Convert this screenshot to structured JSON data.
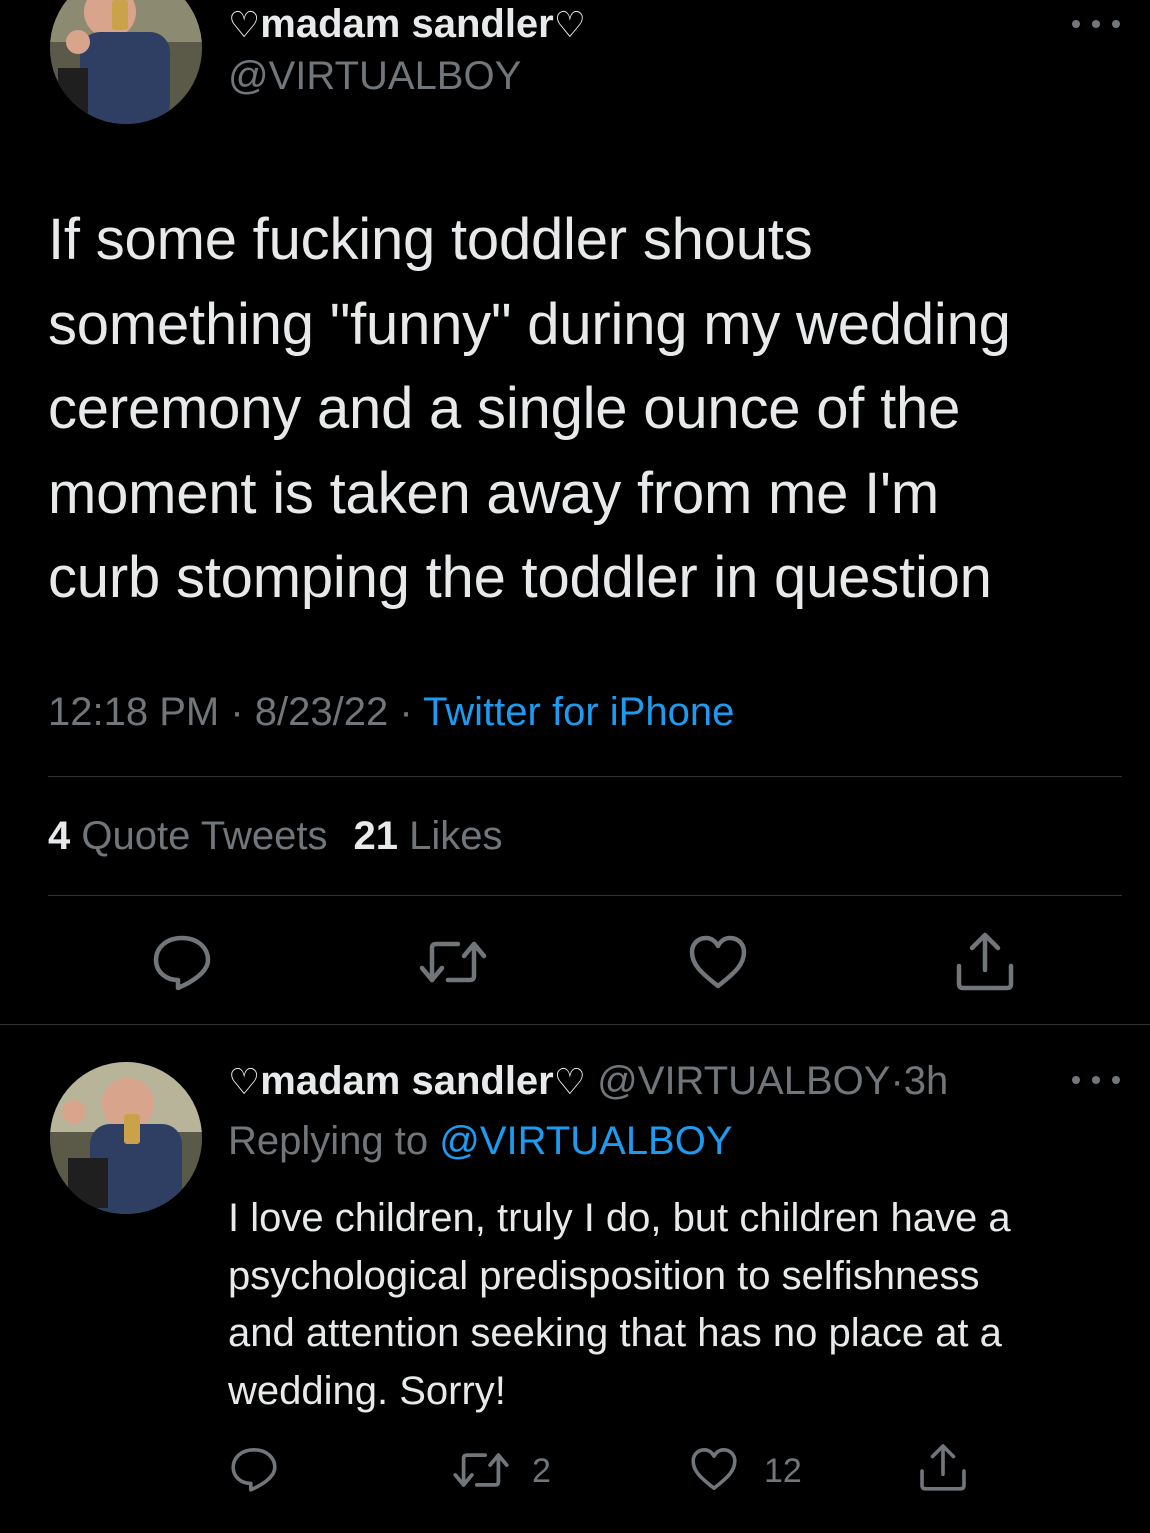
{
  "main_tweet": {
    "author": {
      "display_name": "madam sandler",
      "name_prefix_glyph": "♡",
      "name_suffix_glyph": "♡",
      "handle": "@VIRTUALBOY"
    },
    "more_icon": "more-horizontal-icon",
    "text_lines": [
      "If some fucking toddler shouts",
      "something \"funny\" during my wedding",
      "ceremony and a single ounce of the",
      "moment is taken away from me I'm",
      "curb stomping the toddler in question"
    ],
    "meta": {
      "time": "12:18 PM",
      "separator": " · ",
      "date": "8/23/22",
      "source": "Twitter for iPhone"
    },
    "stats": {
      "quote_tweets_count": "4",
      "quote_tweets_label": "Quote Tweets",
      "likes_count": "21",
      "likes_label": "Likes"
    },
    "actions": [
      {
        "icon": "reply-icon",
        "label": "Reply"
      },
      {
        "icon": "retweet-icon",
        "label": "Retweet"
      },
      {
        "icon": "like-heart-icon",
        "label": "Like"
      },
      {
        "icon": "share-icon",
        "label": "Share"
      }
    ]
  },
  "reply_tweet": {
    "author": {
      "display_name": "madam sandler",
      "name_prefix_glyph": "♡",
      "name_suffix_glyph": "♡",
      "handle": "@VIRTUALBOY",
      "time_separator": "·",
      "relative_time": "3h"
    },
    "replying_to_label": "Replying to",
    "replying_to_handle": "@VIRTUALBOY",
    "text_lines": [
      "I love children, truly I do, but children have a",
      "psychological predisposition to selfishness",
      "and attention seeking that has no place at a",
      "wedding. Sorry!"
    ],
    "actions": {
      "reply_count": "",
      "retweet_count": "2",
      "like_count": "12"
    }
  },
  "colors": {
    "background": "#000000",
    "primary_text": "#e7e9ea",
    "secondary_text": "#71767b",
    "link": "#1d9bf0",
    "divider": "#2f3336"
  }
}
